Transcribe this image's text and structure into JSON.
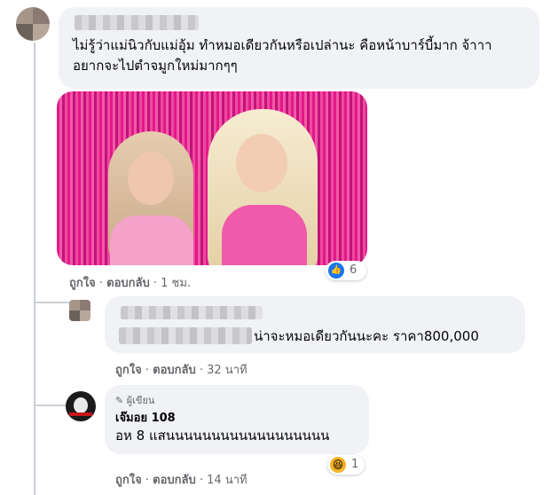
{
  "comment1": {
    "text": "ไม่รู้ว่าแม่นิวกับแม่อุ้ม ทำหมอเดียวกันหรือเปล่านะ คือหน้าบาร์บี้มาก จ้าาา อยากจะไปตำจมูกใหม่มากๆๆ",
    "like_label": "ถูกใจ",
    "reply_label": "ตอบกลับ",
    "time": "1 ชม.",
    "reaction_count": "6",
    "reaction_icon": "like-icon",
    "image_colors": [
      "#e3188a",
      "#f4a2c9",
      "#c2137a"
    ]
  },
  "comment2": {
    "text": "น่าจะหมอเดียวกันนะคะ ราคา800,000",
    "like_label": "ถูกใจ",
    "reply_label": "ตอบกลับ",
    "time": "32 นาที"
  },
  "comment3": {
    "author_badge": "ผู้เขียน",
    "author_name": "เจ๊มอย 108",
    "text": "อห 8 แสนนนนนนนนนนนนนนนนนน",
    "like_label": "ถูกใจ",
    "reply_label": "ตอบกลับ",
    "time": "14 นาที",
    "reaction_count": "1",
    "reaction_icon": "haha-icon"
  },
  "separator": "·",
  "colors": {
    "bubble": "#f0f2f5",
    "meta": "#65676b",
    "like_blue": "#1877f2",
    "haha_yellow": "#f7b125"
  }
}
